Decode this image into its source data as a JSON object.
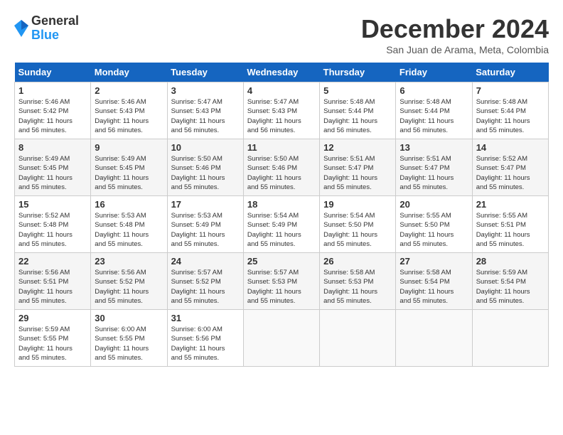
{
  "logo": {
    "general": "General",
    "blue": "Blue"
  },
  "title": "December 2024",
  "subtitle": "San Juan de Arama, Meta, Colombia",
  "weekdays": [
    "Sunday",
    "Monday",
    "Tuesday",
    "Wednesday",
    "Thursday",
    "Friday",
    "Saturday"
  ],
  "weeks": [
    [
      {
        "day": "1",
        "info": "Sunrise: 5:46 AM\nSunset: 5:42 PM\nDaylight: 11 hours\nand 56 minutes."
      },
      {
        "day": "2",
        "info": "Sunrise: 5:46 AM\nSunset: 5:43 PM\nDaylight: 11 hours\nand 56 minutes."
      },
      {
        "day": "3",
        "info": "Sunrise: 5:47 AM\nSunset: 5:43 PM\nDaylight: 11 hours\nand 56 minutes."
      },
      {
        "day": "4",
        "info": "Sunrise: 5:47 AM\nSunset: 5:43 PM\nDaylight: 11 hours\nand 56 minutes."
      },
      {
        "day": "5",
        "info": "Sunrise: 5:48 AM\nSunset: 5:44 PM\nDaylight: 11 hours\nand 56 minutes."
      },
      {
        "day": "6",
        "info": "Sunrise: 5:48 AM\nSunset: 5:44 PM\nDaylight: 11 hours\nand 56 minutes."
      },
      {
        "day": "7",
        "info": "Sunrise: 5:48 AM\nSunset: 5:44 PM\nDaylight: 11 hours\nand 55 minutes."
      }
    ],
    [
      {
        "day": "8",
        "info": "Sunrise: 5:49 AM\nSunset: 5:45 PM\nDaylight: 11 hours\nand 55 minutes."
      },
      {
        "day": "9",
        "info": "Sunrise: 5:49 AM\nSunset: 5:45 PM\nDaylight: 11 hours\nand 55 minutes."
      },
      {
        "day": "10",
        "info": "Sunrise: 5:50 AM\nSunset: 5:46 PM\nDaylight: 11 hours\nand 55 minutes."
      },
      {
        "day": "11",
        "info": "Sunrise: 5:50 AM\nSunset: 5:46 PM\nDaylight: 11 hours\nand 55 minutes."
      },
      {
        "day": "12",
        "info": "Sunrise: 5:51 AM\nSunset: 5:47 PM\nDaylight: 11 hours\nand 55 minutes."
      },
      {
        "day": "13",
        "info": "Sunrise: 5:51 AM\nSunset: 5:47 PM\nDaylight: 11 hours\nand 55 minutes."
      },
      {
        "day": "14",
        "info": "Sunrise: 5:52 AM\nSunset: 5:47 PM\nDaylight: 11 hours\nand 55 minutes."
      }
    ],
    [
      {
        "day": "15",
        "info": "Sunrise: 5:52 AM\nSunset: 5:48 PM\nDaylight: 11 hours\nand 55 minutes."
      },
      {
        "day": "16",
        "info": "Sunrise: 5:53 AM\nSunset: 5:48 PM\nDaylight: 11 hours\nand 55 minutes."
      },
      {
        "day": "17",
        "info": "Sunrise: 5:53 AM\nSunset: 5:49 PM\nDaylight: 11 hours\nand 55 minutes."
      },
      {
        "day": "18",
        "info": "Sunrise: 5:54 AM\nSunset: 5:49 PM\nDaylight: 11 hours\nand 55 minutes."
      },
      {
        "day": "19",
        "info": "Sunrise: 5:54 AM\nSunset: 5:50 PM\nDaylight: 11 hours\nand 55 minutes."
      },
      {
        "day": "20",
        "info": "Sunrise: 5:55 AM\nSunset: 5:50 PM\nDaylight: 11 hours\nand 55 minutes."
      },
      {
        "day": "21",
        "info": "Sunrise: 5:55 AM\nSunset: 5:51 PM\nDaylight: 11 hours\nand 55 minutes."
      }
    ],
    [
      {
        "day": "22",
        "info": "Sunrise: 5:56 AM\nSunset: 5:51 PM\nDaylight: 11 hours\nand 55 minutes."
      },
      {
        "day": "23",
        "info": "Sunrise: 5:56 AM\nSunset: 5:52 PM\nDaylight: 11 hours\nand 55 minutes."
      },
      {
        "day": "24",
        "info": "Sunrise: 5:57 AM\nSunset: 5:52 PM\nDaylight: 11 hours\nand 55 minutes."
      },
      {
        "day": "25",
        "info": "Sunrise: 5:57 AM\nSunset: 5:53 PM\nDaylight: 11 hours\nand 55 minutes."
      },
      {
        "day": "26",
        "info": "Sunrise: 5:58 AM\nSunset: 5:53 PM\nDaylight: 11 hours\nand 55 minutes."
      },
      {
        "day": "27",
        "info": "Sunrise: 5:58 AM\nSunset: 5:54 PM\nDaylight: 11 hours\nand 55 minutes."
      },
      {
        "day": "28",
        "info": "Sunrise: 5:59 AM\nSunset: 5:54 PM\nDaylight: 11 hours\nand 55 minutes."
      }
    ],
    [
      {
        "day": "29",
        "info": "Sunrise: 5:59 AM\nSunset: 5:55 PM\nDaylight: 11 hours\nand 55 minutes."
      },
      {
        "day": "30",
        "info": "Sunrise: 6:00 AM\nSunset: 5:55 PM\nDaylight: 11 hours\nand 55 minutes."
      },
      {
        "day": "31",
        "info": "Sunrise: 6:00 AM\nSunset: 5:56 PM\nDaylight: 11 hours\nand 55 minutes."
      },
      null,
      null,
      null,
      null
    ]
  ]
}
